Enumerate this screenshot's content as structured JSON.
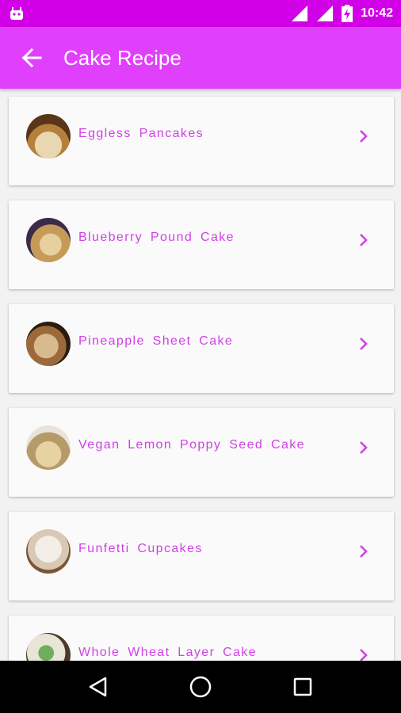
{
  "status_bar": {
    "time": "10:42"
  },
  "app_bar": {
    "title": "Cake Recipe"
  },
  "recipes": [
    {
      "label": "Eggless Pancakes"
    },
    {
      "label": "Blueberry Pound Cake"
    },
    {
      "label": "Pineapple Sheet Cake"
    },
    {
      "label": "Vegan Lemon Poppy Seed Cake"
    },
    {
      "label": "Funfetti Cupcakes"
    },
    {
      "label": "Whole Wheat Layer Cake"
    }
  ],
  "colors": {
    "status_bar": "#d100e6",
    "app_bar": "#e040fb",
    "text_accent": "#d041e6"
  },
  "icons": {
    "back": "arrow-left-icon",
    "chevron": "chevron-right-icon",
    "nav": [
      "back-triangle-icon",
      "home-circle-icon",
      "recents-square-icon"
    ]
  }
}
